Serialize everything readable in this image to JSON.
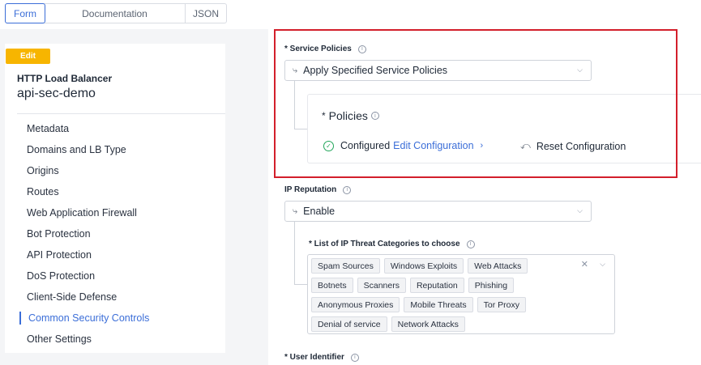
{
  "tabs": [
    {
      "label": "Form",
      "active": true
    },
    {
      "label": "Documentation",
      "active": false
    },
    {
      "label": "JSON",
      "active": false
    }
  ],
  "card": {
    "badge": "Edit",
    "type": "HTTP Load Balancer",
    "name": "api-sec-demo"
  },
  "nav": [
    "Metadata",
    "Domains and LB Type",
    "Origins",
    "Routes",
    "Web Application Firewall",
    "Bot Protection",
    "API Protection",
    "DoS Protection",
    "Client-Side Defense",
    "Common Security Controls",
    "Other Settings"
  ],
  "nav_active_index": 9,
  "service_policies": {
    "label": "* Service Policies",
    "value": "Apply Specified Service Policies",
    "policies_title": "Policies",
    "status": "Configured",
    "edit_link": "Edit Configuration",
    "reset": "Reset Configuration"
  },
  "ip_reputation": {
    "label": "IP Reputation",
    "value": "Enable",
    "list_label": "* List of IP Threat Categories to choose",
    "chips": [
      [
        "Spam Sources",
        "Windows Exploits",
        "Web Attacks"
      ],
      [
        "Botnets",
        "Scanners",
        "Reputation",
        "Phishing"
      ],
      [
        "Anonymous Proxies",
        "Mobile Threats",
        "Tor Proxy"
      ],
      [
        "Denial of service",
        "Network Attacks"
      ]
    ]
  },
  "user_identifier": {
    "label": "* User Identifier"
  },
  "colors": {
    "accent": "#3b6ed8",
    "badge": "#f7b500",
    "highlight": "#d31f2b",
    "success": "#22a65a"
  }
}
